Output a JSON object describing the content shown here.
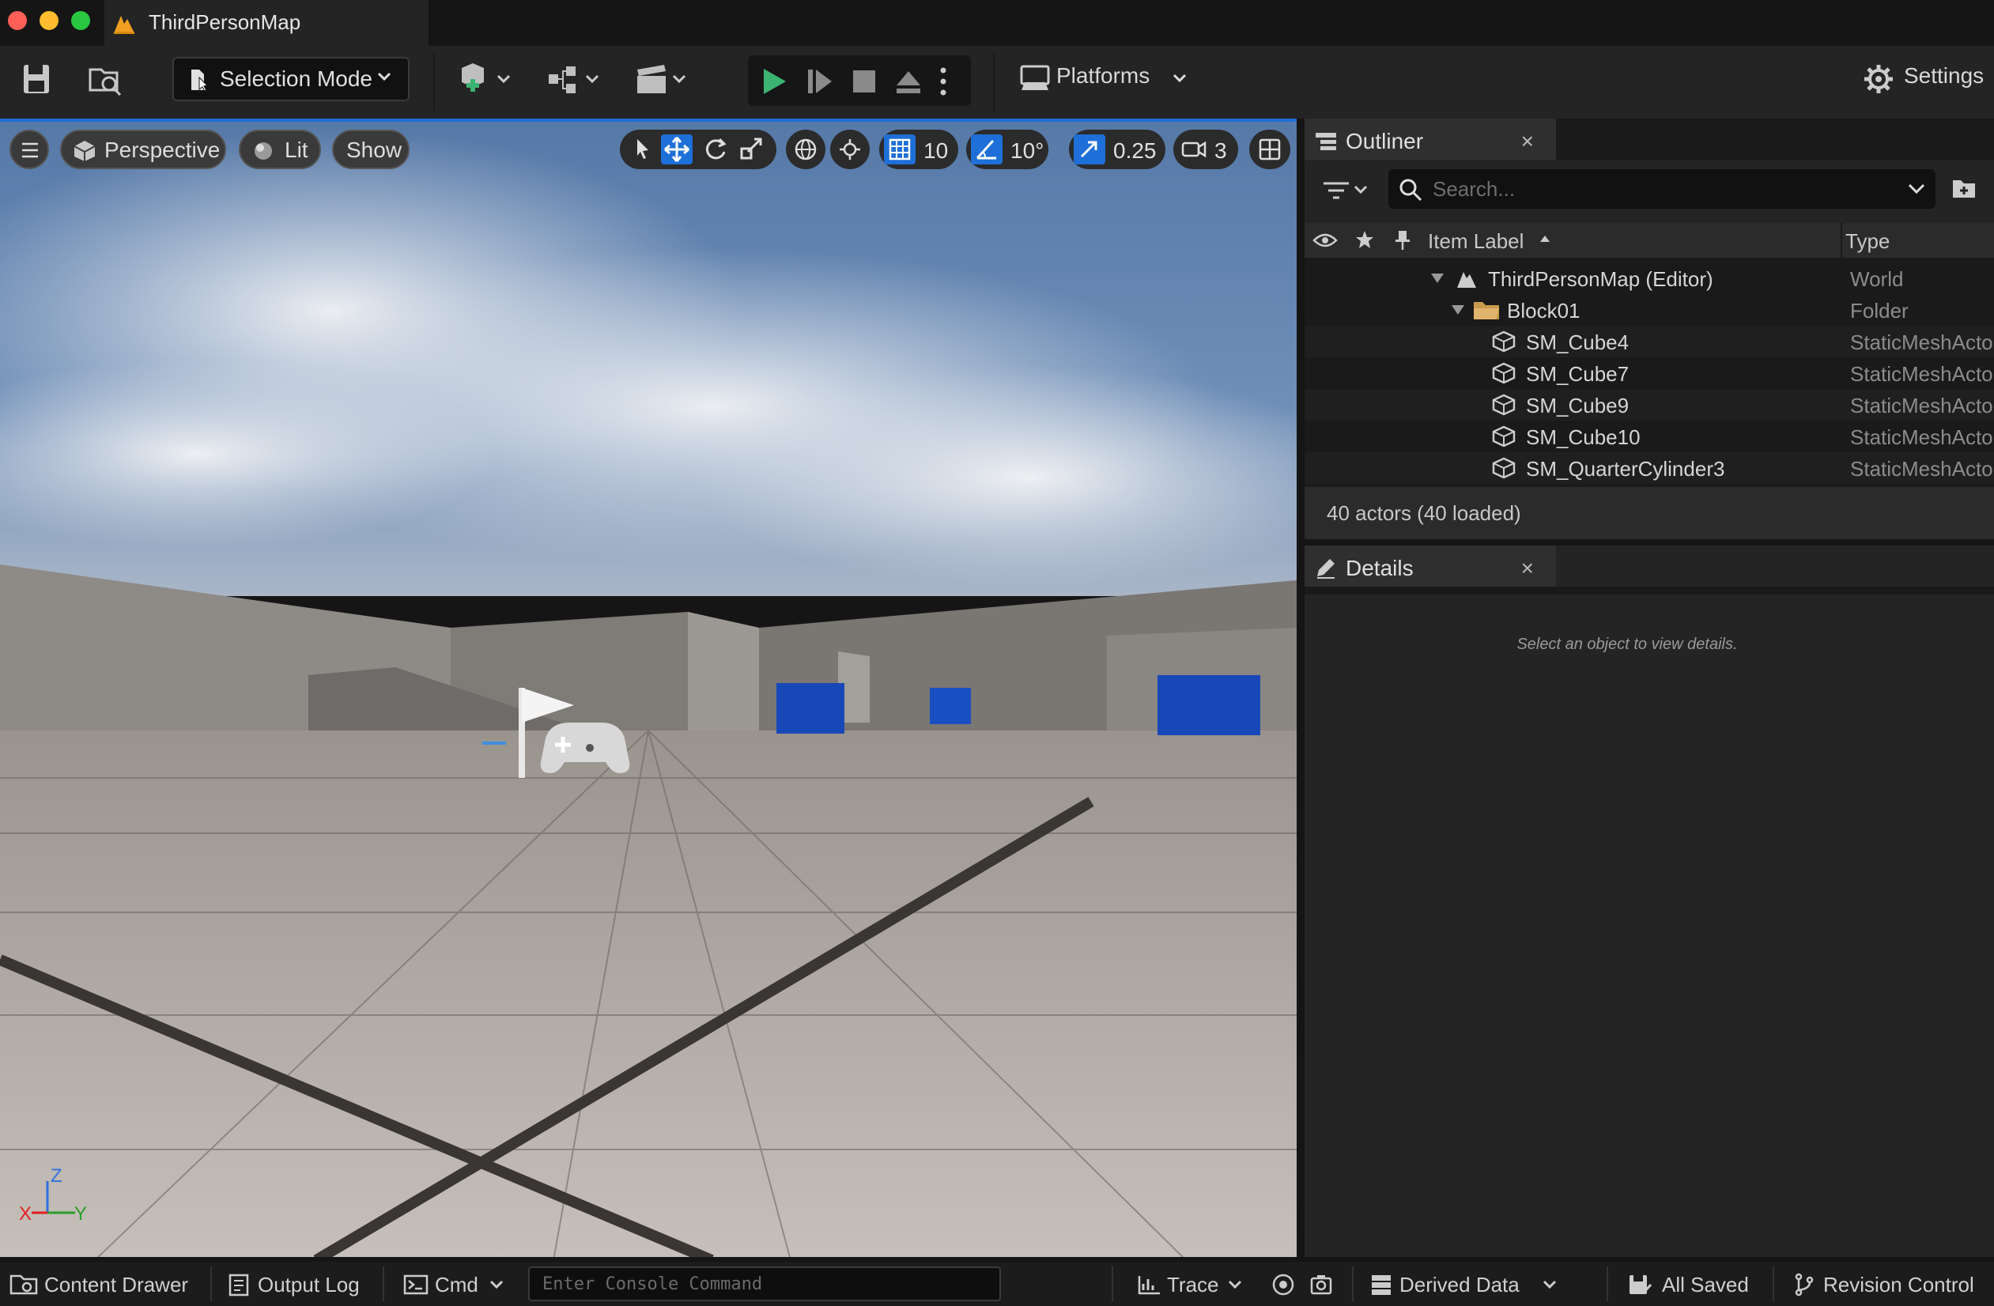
{
  "window": {
    "title": "ThirdPersonMap"
  },
  "toolbar": {
    "selection_mode": "Selection Mode",
    "platforms": "Platforms",
    "settings": "Settings"
  },
  "viewport": {
    "perspective": "Perspective",
    "lit": "Lit",
    "show": "Show",
    "grid_snap": "10",
    "rotation_snap": "10°",
    "scale_snap": "0.25",
    "camera_speed": "3",
    "axes": {
      "z": "Z",
      "x": "X",
      "y": "Y"
    }
  },
  "outliner": {
    "title": "Outliner",
    "close": "×",
    "search_placeholder": "Search...",
    "col_label": "Item Label",
    "col_type": "Type",
    "rows": [
      {
        "label": "ThirdPersonMap (Editor)",
        "type": "World"
      },
      {
        "label": "Block01",
        "type": "Folder"
      },
      {
        "label": "SM_Cube4",
        "type": "StaticMeshActor"
      },
      {
        "label": "SM_Cube7",
        "type": "StaticMeshActor"
      },
      {
        "label": "SM_Cube9",
        "type": "StaticMeshActor"
      },
      {
        "label": "SM_Cube10",
        "type": "StaticMeshActor"
      },
      {
        "label": "SM_QuarterCylinder3",
        "type": "StaticMeshActor"
      }
    ],
    "footer": "40 actors (40 loaded)"
  },
  "details": {
    "title": "Details",
    "close": "×",
    "empty": "Select an object to view details."
  },
  "statusbar": {
    "content_drawer": "Content Drawer",
    "output_log": "Output Log",
    "cmd": "Cmd",
    "console_placeholder": "Enter Console Command",
    "trace": "Trace",
    "derived_data": "Derived Data",
    "all_saved": "All Saved",
    "revision_control": "Revision Control"
  },
  "colors": {
    "accent": "#1e6fd8",
    "play": "#3cb371",
    "folder": "#c99b4d"
  }
}
